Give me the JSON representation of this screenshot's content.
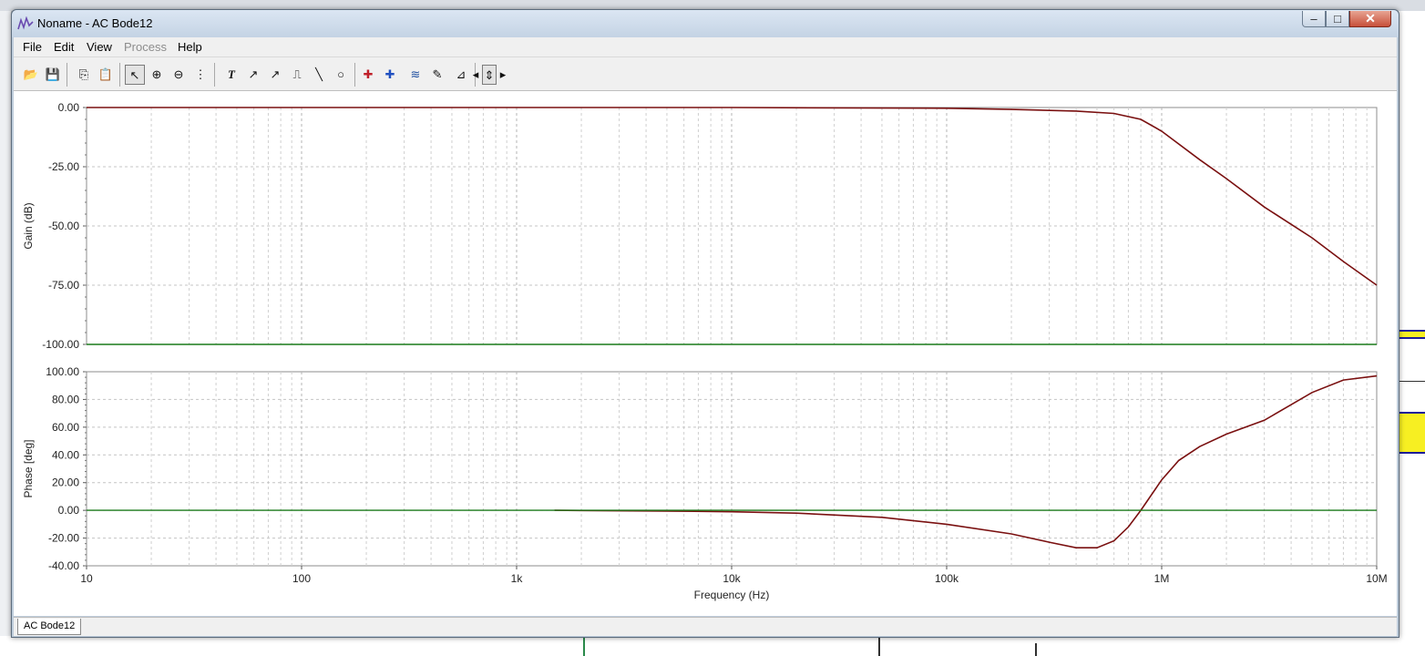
{
  "window": {
    "title": "Noname - AC Bode12",
    "minimize_glyph": "–",
    "maximize_glyph": "□",
    "close_glyph": "✕"
  },
  "menu": [
    {
      "label": "File",
      "enabled": true
    },
    {
      "label": "Edit",
      "enabled": true
    },
    {
      "label": "View",
      "enabled": true
    },
    {
      "label": "Process",
      "enabled": false
    },
    {
      "label": "Help",
      "enabled": true
    }
  ],
  "toolbar": [
    {
      "icon": "open-folder-icon",
      "glyph": "📂"
    },
    {
      "icon": "save-disk-icon",
      "glyph": "💾"
    },
    {
      "icon": "copy-icon",
      "glyph": "⎘"
    },
    {
      "icon": "paste-icon",
      "glyph": "📋"
    },
    {
      "icon": "select-arrow-icon",
      "glyph": "↖"
    },
    {
      "icon": "zoom-in-icon",
      "glyph": "⊕"
    },
    {
      "icon": "zoom-out-icon",
      "glyph": "⊖"
    },
    {
      "icon": "grid-icon",
      "glyph": "⋮"
    },
    {
      "icon": "text-tool-icon",
      "glyph": "T"
    },
    {
      "icon": "curve-label-icon",
      "glyph": "↗"
    },
    {
      "icon": "curve-label-2-icon",
      "glyph": "↗"
    },
    {
      "icon": "step-label-icon",
      "glyph": "⎍"
    },
    {
      "icon": "line-tool-icon",
      "glyph": "╲"
    },
    {
      "icon": "circle-tool-icon",
      "glyph": "○"
    },
    {
      "icon": "cursor-a-icon",
      "glyph": "✚"
    },
    {
      "icon": "cursor-b-icon",
      "glyph": "✚"
    },
    {
      "icon": "wave-tool-icon",
      "glyph": "≋"
    },
    {
      "icon": "probe-pen-icon",
      "glyph": "✎"
    },
    {
      "icon": "flag-icon",
      "glyph": "⊿"
    },
    {
      "icon": "nav-left-icon",
      "glyph": "◂"
    },
    {
      "icon": "nav-updown-icon",
      "glyph": "⇕"
    },
    {
      "icon": "nav-right-icon",
      "glyph": "▸"
    }
  ],
  "tabs": [
    {
      "label": "AC Bode12",
      "active": true
    }
  ],
  "chart_data": [
    {
      "type": "line",
      "ylabel": "Gain (dB)",
      "xscale": "log",
      "xlim": [
        10,
        10000000
      ],
      "ylim": [
        -100,
        0
      ],
      "yticks": [
        0,
        -25,
        -50,
        -75,
        -100
      ],
      "ytick_labels": [
        "0.00",
        "-25.00",
        "-50.00",
        "-75.00",
        "-100.00"
      ],
      "grid": true,
      "series": [
        {
          "color": "#7a1010",
          "x": [
            10,
            100,
            1000,
            10000,
            100000,
            200000,
            400000,
            600000,
            800000,
            1000000,
            1500000,
            2000000,
            3000000,
            5000000,
            7000000,
            10000000
          ],
          "y": [
            0,
            0,
            0,
            0,
            -0.3,
            -0.8,
            -1.5,
            -2.5,
            -5,
            -10,
            -22,
            -30,
            -42,
            -55,
            -65,
            -75
          ]
        },
        {
          "color": "#1a7a1a",
          "x": [
            10,
            10000000
          ],
          "y": [
            -100,
            -100
          ]
        }
      ]
    },
    {
      "type": "line",
      "ylabel": "Phase [deg]",
      "xlabel": "Frequency (Hz)",
      "xscale": "log",
      "xlim": [
        10,
        10000000
      ],
      "ylim": [
        -40,
        100
      ],
      "yticks": [
        100,
        80,
        60,
        40,
        20,
        0,
        -20,
        -40
      ],
      "ytick_labels": [
        "100.00",
        "80.00",
        "60.00",
        "40.00",
        "20.00",
        "0.00",
        "-20.00",
        "-40.00"
      ],
      "xticks": [
        10,
        100,
        1000,
        10000,
        100000,
        1000000,
        10000000
      ],
      "xtick_labels": [
        "10",
        "100",
        "1k",
        "10k",
        "100k",
        "1M",
        "10M"
      ],
      "grid": true,
      "series": [
        {
          "color": "#7a1010",
          "x": [
            1500,
            5000,
            10000,
            20000,
            50000,
            100000,
            200000,
            300000,
            400000,
            500000,
            600000,
            700000,
            800000,
            1000000,
            1200000,
            1500000,
            2000000,
            3000000,
            5000000,
            7000000,
            10000000
          ],
          "y": [
            0,
            -0.5,
            -1,
            -2,
            -5,
            -10,
            -17,
            -23,
            -27,
            -27,
            -22,
            -12,
            0,
            22,
            36,
            46,
            55,
            65,
            85,
            94,
            97
          ]
        },
        {
          "color": "#1a7a1a",
          "x": [
            10,
            10000000
          ],
          "y": [
            0,
            0
          ]
        }
      ]
    }
  ]
}
